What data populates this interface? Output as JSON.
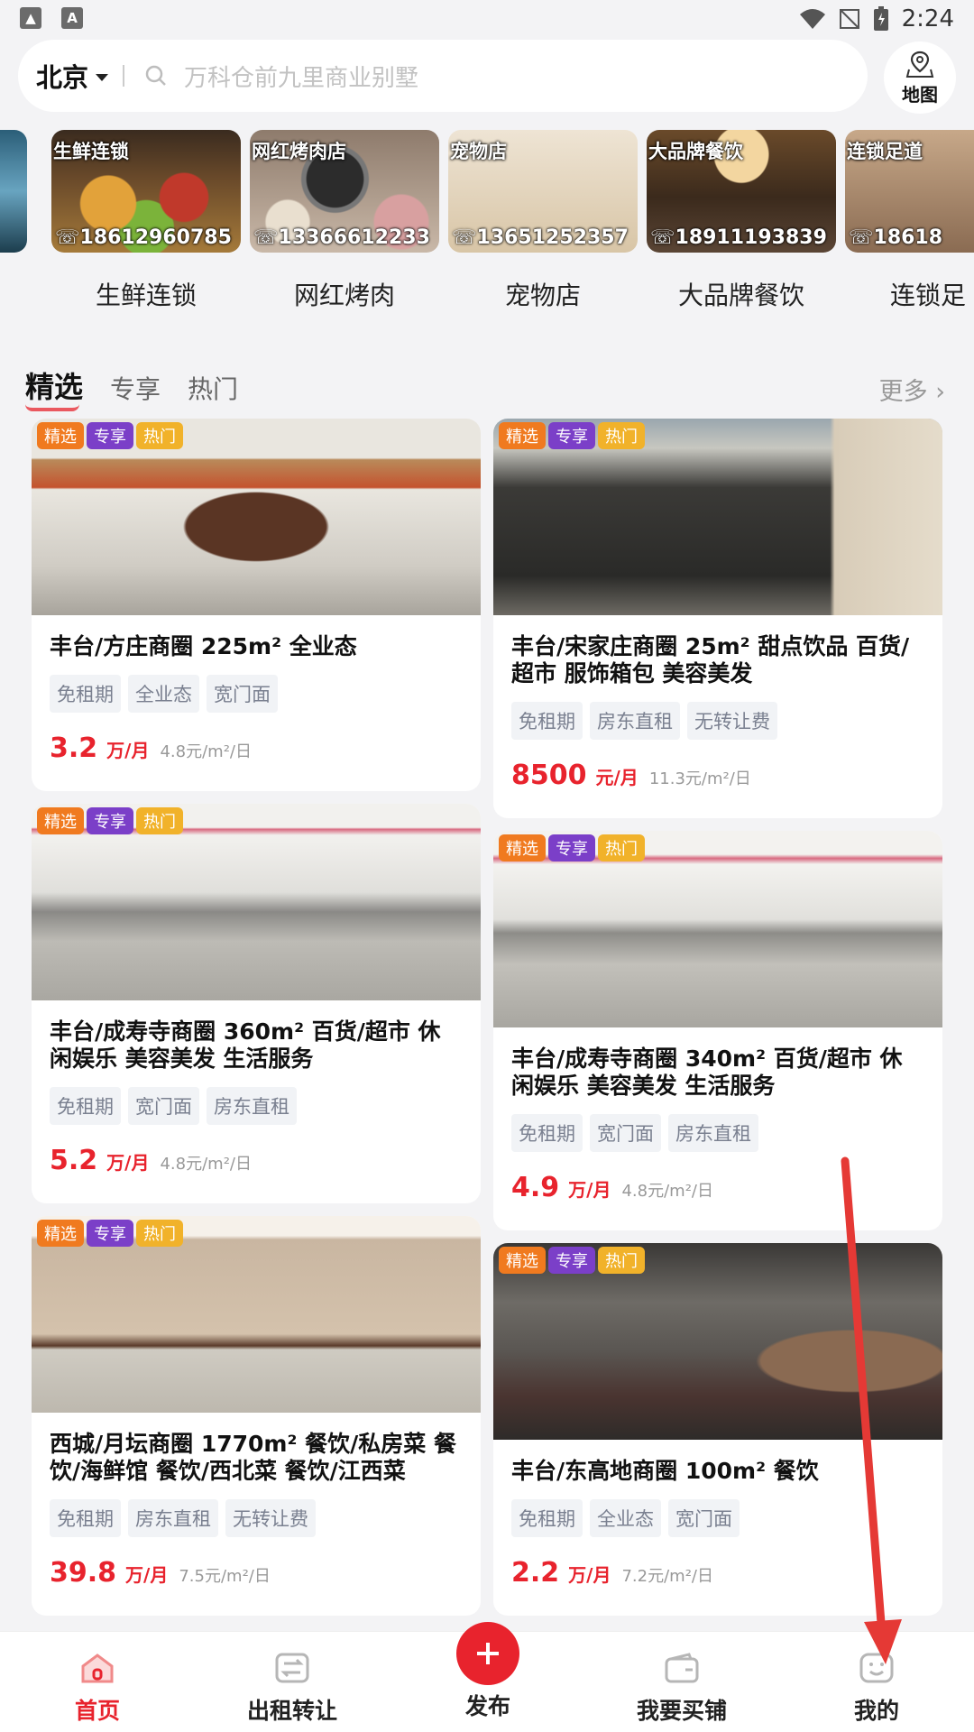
{
  "status_bar": {
    "time": "2:24"
  },
  "header": {
    "city": "北京",
    "search_placeholder": "万科仓前九里商业别墅",
    "map_label": "地图"
  },
  "categories": [
    {
      "thumb_title": "",
      "phone": "",
      "label": ""
    },
    {
      "thumb_title": "生鲜连锁",
      "phone": "☏18612960785",
      "label": "生鲜连锁"
    },
    {
      "thumb_title": "网红烤肉店",
      "phone": "☏13366612233",
      "label": "网红烤肉"
    },
    {
      "thumb_title": "宠物店",
      "phone": "☏13651252357",
      "label": "宠物店"
    },
    {
      "thumb_title": "大品牌餐饮",
      "phone": "☏18911193839",
      "label": "大品牌餐饮"
    },
    {
      "thumb_title": "连锁足道",
      "phone": "☏18618",
      "label": "连锁足"
    }
  ],
  "tabs": [
    {
      "label": "精选",
      "active": true
    },
    {
      "label": "专享",
      "active": false
    },
    {
      "label": "热门",
      "active": false
    }
  ],
  "more_label": "更多 ›",
  "badges": {
    "jx": "精选",
    "zx": "专享",
    "rm": "热门"
  },
  "listings_left": [
    {
      "title": "丰台/方庄商圈 225m² 全业态",
      "tags": [
        "免租期",
        "全业态",
        "宽门面"
      ],
      "price": "3.2",
      "unit": "万/月",
      "sub": "4.8元/m²/日"
    },
    {
      "title": "丰台/成寿寺商圈 360m² 百货/超市 休闲娱乐 美容美发 生活服务",
      "tags": [
        "免租期",
        "宽门面",
        "房东直租"
      ],
      "price": "5.2",
      "unit": "万/月",
      "sub": "4.8元/m²/日"
    },
    {
      "title": "西城/月坛商圈 1770m² 餐饮/私房菜 餐饮/海鲜馆 餐饮/西北菜 餐饮/江西菜",
      "tags": [
        "免租期",
        "房东直租",
        "无转让费"
      ],
      "price": "39.8",
      "unit": "万/月",
      "sub": "7.5元/m²/日"
    }
  ],
  "listings_right": [
    {
      "title": "丰台/宋家庄商圈 25m² 甜点饮品 百货/超市 服饰箱包 美容美发",
      "tags": [
        "免租期",
        "房东直租",
        "无转让费"
      ],
      "price": "8500",
      "unit": "元/月",
      "sub": "11.3元/m²/日"
    },
    {
      "title": "丰台/成寿寺商圈 340m² 百货/超市 休闲娱乐 美容美发 生活服务",
      "tags": [
        "免租期",
        "宽门面",
        "房东直租"
      ],
      "price": "4.9",
      "unit": "万/月",
      "sub": "4.8元/m²/日"
    },
    {
      "title": "丰台/东高地商圈 100m² 餐饮",
      "tags": [
        "免租期",
        "全业态",
        "宽门面"
      ],
      "price": "2.2",
      "unit": "万/月",
      "sub": "7.2元/m²/日"
    }
  ],
  "bottom_nav": {
    "home": "首页",
    "rent": "出租转让",
    "publish": "发布",
    "buy": "我要买铺",
    "mine": "我的"
  },
  "colors": {
    "accent": "#e8232d",
    "badge_jx": "#f07a1f",
    "badge_zx": "#7b3fc8",
    "badge_rm": "#f1b22a"
  }
}
